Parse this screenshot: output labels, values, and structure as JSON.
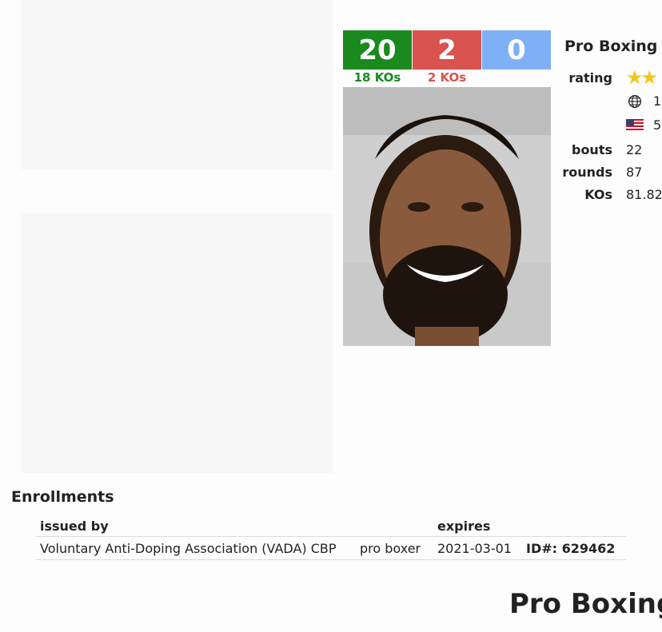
{
  "record": {
    "wins": "20",
    "losses": "2",
    "draws": "0",
    "wins_kos": "18 KOs",
    "losses_kos": "2 KOs",
    "colors": {
      "win": "#1a8a1f",
      "loss": "#d9534f",
      "draw": "#7fb0f5"
    }
  },
  "stats": {
    "title": "Pro Boxing",
    "rating_label": "rating",
    "rating_stars": "★★",
    "world_rank": "1",
    "world_rank_icon": "globe-icon",
    "country_rank": "5",
    "country_rank_icon": "us-flag-icon",
    "bouts_label": "bouts",
    "bouts": "22",
    "rounds_label": "rounds",
    "rounds": "87",
    "kos_label": "KOs",
    "kos_pct": "81.82"
  },
  "enrollments": {
    "title": "Enrollments",
    "columns": [
      "issued by",
      "",
      "expires",
      ""
    ],
    "rows": [
      {
        "issued_by": "Voluntary Anti-Doping Association (VADA) CBP",
        "role": "pro boxer",
        "expires": "2021-03-01",
        "id_label": "ID#:",
        "id_value": "629462"
      }
    ]
  },
  "footer": {
    "title": "Pro Boxing"
  }
}
